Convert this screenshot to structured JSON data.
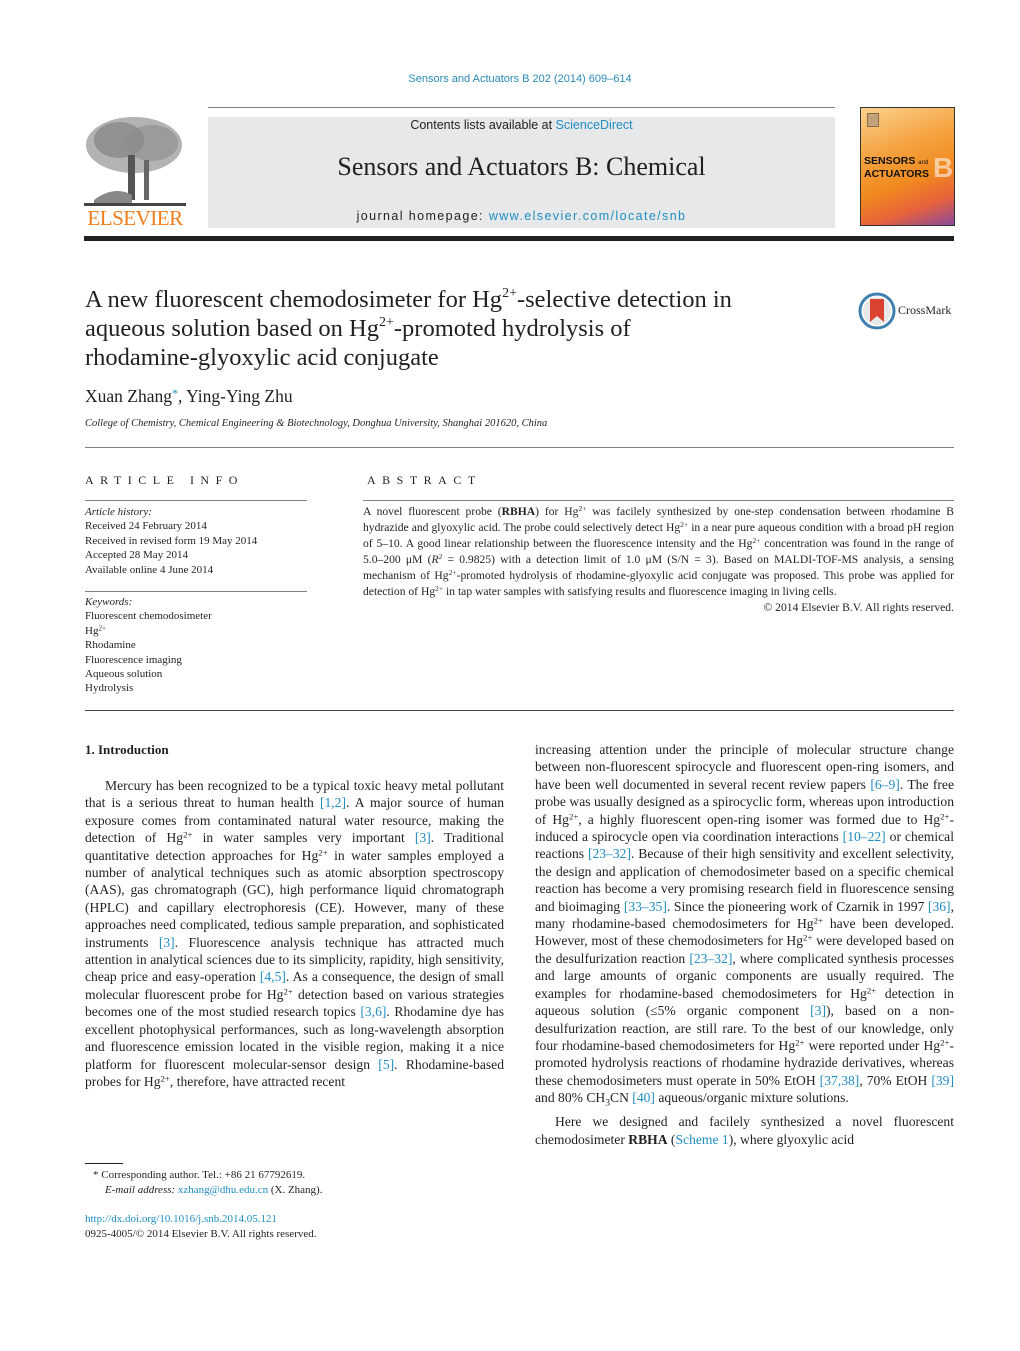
{
  "header": {
    "journal_reference": "Sensors and Actuators B 202 (2014) 609–614",
    "contents_prefix": "Contents lists available at ",
    "contents_link": "ScienceDirect",
    "journal_title": "Sensors and Actuators B: Chemical",
    "homepage_prefix": "journal homepage: ",
    "homepage_link": "www.elsevier.com/locate/snb",
    "publisher_logo_text": "ELSEVIER",
    "cover": {
      "title_line1": "SENSORS",
      "and": "and",
      "title_line2": "ACTUATORS",
      "letter": "B"
    },
    "colors": {
      "link": "#1f8dc1",
      "elsevier_orange": "#f07d1a",
      "band_gray": "#e7e8e9"
    }
  },
  "article": {
    "title_parts": {
      "p1": "A new fluorescent chemodosimeter for Hg",
      "sup1": "2+",
      "p2": "-selective detection in",
      "p3": "aqueous solution based on Hg",
      "sup2": "2+",
      "p4": "-promoted hydrolysis of",
      "p5": "rhodamine-glyoxylic acid conjugate"
    },
    "crossmark_label": "CrossMark",
    "authors": {
      "author1": "Xuan Zhang",
      "author1_mark": "*",
      "separator": ", ",
      "author2": "Ying-Ying Zhu"
    },
    "affiliation": "College of Chemistry, Chemical Engineering & Biotechnology, Donghua University, Shanghai 201620, China"
  },
  "article_info": {
    "heading": "ARTICLE INFO",
    "history_label": "Article history:",
    "history": [
      "Received 24 February 2014",
      "Received in revised form 19 May 2014",
      "Accepted 28 May 2014",
      "Available online 4 June 2014"
    ],
    "keywords_label": "Keywords:",
    "keywords": [
      "Fluorescent chemodosimeter",
      "Hg",
      "Rhodamine",
      "Fluorescence imaging",
      "Aqueous solution",
      "Hydrolysis"
    ],
    "keyword_hg_sup": "2+"
  },
  "abstract": {
    "heading": "ABSTRACT",
    "s1": "A novel fluorescent probe (",
    "probe": "RBHA",
    "s2": ") for Hg",
    "s3": " was facilely synthesized by one-step condensation between rhodamine B hydrazide and glyoxylic acid. The probe could selectively detect Hg",
    "s4": " in a near pure aqueous condition with a broad pH region of 5–10. A good linear relationship between the fluorescence intensity and the Hg",
    "s5": " concentration was found in the range of 5.0–200 μM (",
    "r": "R",
    "r_sup": "2",
    "s6": " = 0.9825) with a detection limit of 1.0 μM (S/N = 3). Based on MALDI-TOF-MS analysis, a sensing mechanism of Hg",
    "s7": "-promoted hydrolysis of rhodamine-glyoxylic acid conjugate was proposed. This probe was applied for detection of Hg",
    "s8": " in tap water samples with satisfying results and fluorescence imaging in living cells.",
    "sup": "2+",
    "copyright": "© 2014 Elsevier B.V. All rights reserved."
  },
  "introduction": {
    "heading": "1.  Introduction",
    "left": {
      "a1": "Mercury has been recognized to be a typical toxic heavy metal pollutant that is a serious threat to human health ",
      "c1": "[1,2]",
      "a2": ". A major source of human exposure comes from contaminated natural water resource, making the detection of Hg",
      "a3": " in water samples very important ",
      "c2": "[3]",
      "a4": ". Traditional quantitative detection approaches for Hg",
      "a5": " in water samples employed a number of analytical techniques such as atomic absorption spectroscopy (AAS), gas chromatograph (GC), high performance liquid chromatograph (HPLC) and capillary electrophoresis (CE). However, many of these approaches need complicated, tedious sample preparation, and sophisticated instruments ",
      "c3": "[3]",
      "a6": ". Fluorescence analysis technique has attracted much attention in analytical sciences due to its simplicity, rapidity, high sensitivity, cheap price and easy-operation ",
      "c4": "[4,5]",
      "a7": ". As a consequence, the design of small molecular fluorescent probe for Hg",
      "a8": " detection based on various strategies becomes one of the most studied research topics ",
      "c5": "[3,6]",
      "a9": ". Rhodamine dye has excellent photophysical performances, such as long-wavelength absorption and fluorescence emission located in the visible region, making it a nice platform for fluorescent molecular-sensor design ",
      "c6": "[5]",
      "a10": ". Rhodamine-based probes for Hg",
      "a11": ", therefore, have attracted recent"
    },
    "right": {
      "b1": "increasing attention under the principle of molecular structure change between non-fluorescent spirocycle and fluorescent open-ring isomers, and have been well documented in several recent review papers ",
      "c7": "[6–9]",
      "b2": ". The free probe was usually designed as a spirocyclic form, whereas upon introduction of Hg",
      "b3": ", a highly fluorescent open-ring isomer was formed due to Hg",
      "b4": "-induced a spirocycle open via coordination interactions ",
      "c8": "[10–22]",
      "b5": " or chemical reactions ",
      "c9": "[23–32]",
      "b6": ". Because of their high sensitivity and excellent selectivity, the design and application of chemodosimeter based on a specific chemical reaction has become a very promising research field in fluorescence sensing and bioimaging ",
      "c10": "[33–35]",
      "b7": ". Since the pioneering work of Czarnik in 1997 ",
      "c11": "[36]",
      "b8": ", many rhodamine-based chemodosimeters for Hg",
      "b9": " have been developed. However, most of these chemodosimeters for Hg",
      "b10": " were developed based on the desulfurization reaction ",
      "c12": "[23–32]",
      "b11": ", where complicated synthesis processes and large amounts of organic components are usually required. The examples for rhodamine-based chemodosimeters for Hg",
      "b12": " detection in aqueous solution (≤5% organic component ",
      "c13": "[3]",
      "b13": "), based on a non-desulfurization reaction, are still rare. To the best of our knowledge, only four rhodamine-based chemodosimeters for Hg",
      "b14": " were reported under Hg",
      "b15": "-promoted hydrolysis reactions of rhodamine hydrazide derivatives, whereas these chemodosimeters must operate in 50% EtOH ",
      "c14": "[37,38]",
      "b16": ", 70% EtOH ",
      "c15": "[39]",
      "b17": " and 80% CH",
      "sub3": "3",
      "b18": "CN ",
      "c16": "[40]",
      "b19": " aqueous/organic mixture solutions.",
      "p2a": "Here we designed and facilely synthesized a novel fluorescent chemodosimeter ",
      "probe": "RBHA",
      "p2b": " (",
      "scheme_link": "Scheme 1",
      "p2c": "), where glyoxylic acid"
    },
    "sup": "2+"
  },
  "footnotes": {
    "mark": "*",
    "corresponding": " Corresponding author. Tel.: +86 21 67792619.",
    "email_label": "E-mail address:",
    "email": "xzhang@dhu.edu.cn",
    "email_suffix": " (X. Zhang).",
    "doi": "http://dx.doi.org/10.1016/j.snb.2014.05.121",
    "issn_copyright": "0925-4005/© 2014 Elsevier B.V. All rights reserved."
  }
}
